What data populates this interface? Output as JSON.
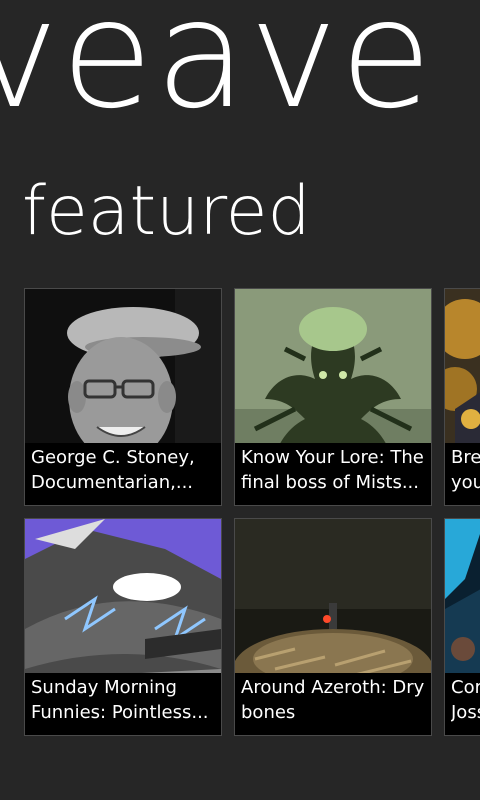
{
  "app": {
    "title": "veave"
  },
  "section": {
    "title": "featured"
  },
  "tiles": [
    {
      "line1": "George C. Stoney,",
      "line2": "Documentarian,...",
      "image": "elderly-man-flat-cap-portrait"
    },
    {
      "line1": "Know Your Lore: The",
      "line2": "final boss of Mists...",
      "image": "green-monster-illustration"
    },
    {
      "line1": "Bre",
      "line2": "you",
      "image": "fantasy-armor-art"
    },
    {
      "line1": "Sunday Morning",
      "line2": "Funnies: Pointless...",
      "image": "cartoon-dragon-lightning"
    },
    {
      "line1": "Around Azeroth: Dry",
      "line2": "bones",
      "image": "bone-pile-scene"
    },
    {
      "line1": "Cor",
      "line2": "Joss",
      "image": "blue-character-art"
    }
  ]
}
